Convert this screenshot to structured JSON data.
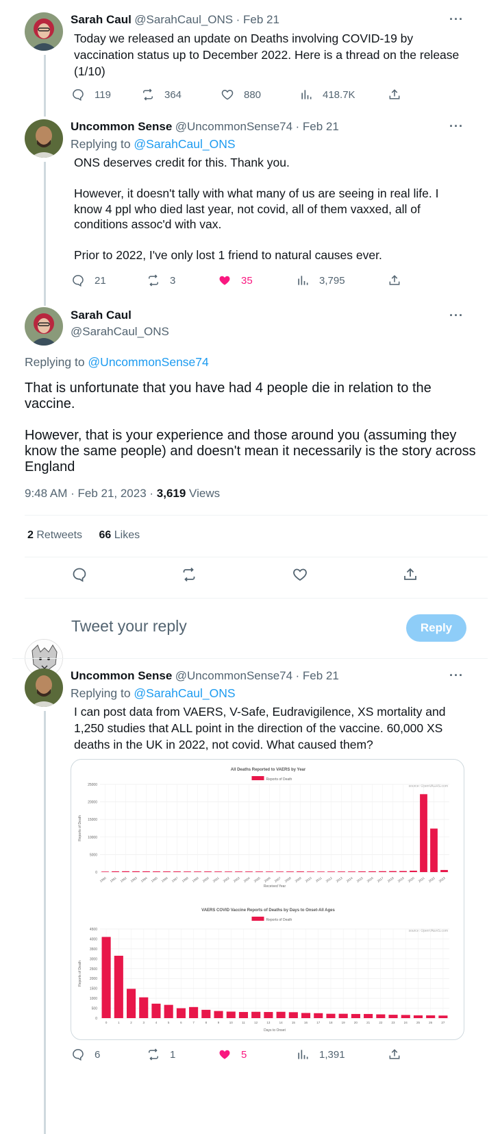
{
  "colors": {
    "accent": "#1d9bf0",
    "like": "#f91880",
    "bar": "#e8174a",
    "muted": "#536471"
  },
  "tweet1": {
    "name": "Sarah Caul",
    "handle": "@SarahCaul_ONS",
    "time": "· Feb 21",
    "text": "Today we released an update on Deaths involving COVID-19 by vaccination status up to December 2022. Here is a thread on the release (1/10)",
    "replies": "119",
    "retweets": "364",
    "likes": "880",
    "views": "418.7K"
  },
  "tweet2": {
    "name": "Uncommon Sense",
    "handle": "@UncommonSense74",
    "time": "· Feb 21",
    "replying_prefix": "Replying to ",
    "replying_to": "@SarahCaul_ONS",
    "text": "ONS deserves credit for this. Thank you.\n\nHowever, it doesn't tally with what many of us are seeing in real life. I know 4 ppl who died last year, not covid, all of them vaxxed, all of conditions assoc'd with vax.\n\nPrior to 2022, I've only lost 1 friend to natural causes ever.",
    "replies": "21",
    "retweets": "3",
    "likes": "35",
    "views": "3,795"
  },
  "main_tweet": {
    "name": "Sarah Caul",
    "handle": "@SarahCaul_ONS",
    "replying_prefix": "Replying to ",
    "replying_to": "@UncommonSense74",
    "text": "That is unfortunate that you have had 4 people die in relation to the vaccine.\n\nHowever, that is your experience and those around you (assuming they know the same people) and doesn't mean it necessarily is the story across England",
    "timestamp": "9:48 AM · Feb 21, 2023 · ",
    "views_count": "3,619",
    "views_label": " Views",
    "retweets_count": "2",
    "retweets_label": " Retweets",
    "likes_count": "66",
    "likes_label": " Likes"
  },
  "compose": {
    "placeholder": "Tweet your reply",
    "button": "Reply"
  },
  "tweet3": {
    "name": "Uncommon Sense",
    "handle": "@UncommonSense74",
    "time": "· Feb 21",
    "replying_prefix": "Replying to ",
    "replying_to": "@SarahCaul_ONS",
    "text": "I can post data from VAERS, V-Safe, Eudravigilence, XS mortality and 1,250 studies that ALL point in the direction of the vaccine. 60,000 XS deaths in the UK in 2022, not covid. What caused them?",
    "replies": "6",
    "retweets": "1",
    "likes": "5",
    "views": "1,391"
  },
  "chart_data": [
    {
      "type": "bar",
      "title": "All Deaths Reported to VAERS by Year",
      "legend": "Reports of Death",
      "source": "source: OpenVAERS.com",
      "xlabel": "Received Year",
      "ylabel": "Reports of Death",
      "ylim": [
        0,
        25000
      ],
      "yticks": [
        0,
        5000,
        10000,
        15000,
        20000,
        25000
      ],
      "categories": [
        "1990",
        "1991",
        "1992",
        "1993",
        "1994",
        "1995",
        "1996",
        "1997",
        "1998",
        "1999",
        "2000",
        "2001",
        "2002",
        "2003",
        "2004",
        "2005",
        "2006",
        "2007",
        "2008",
        "2009",
        "2010",
        "2011",
        "2012",
        "2013",
        "2014",
        "2015",
        "2016",
        "2017",
        "2018",
        "2019",
        "2020",
        "2021",
        "2022",
        "2023"
      ],
      "values": [
        150,
        220,
        240,
        230,
        220,
        200,
        190,
        190,
        170,
        170,
        180,
        170,
        160,
        170,
        170,
        170,
        160,
        160,
        170,
        190,
        160,
        150,
        160,
        170,
        170,
        200,
        220,
        250,
        280,
        300,
        400,
        22200,
        12400,
        600
      ],
      "grid": true
    },
    {
      "type": "bar",
      "title": "VAERS COVID Vaccine Reports of Deaths by Days to Onset-All Ages",
      "legend": "Reports of Death",
      "source": "source: OpenVAERS.com",
      "xlabel": "Days to Onset",
      "ylabel": "Reports of Death",
      "ylim": [
        0,
        4500
      ],
      "yticks": [
        0,
        500,
        1000,
        1500,
        2000,
        2500,
        3000,
        3500,
        4000,
        4500
      ],
      "categories": [
        "0",
        "1",
        "2",
        "3",
        "4",
        "5",
        "6",
        "7",
        "8",
        "9",
        "10",
        "11",
        "12",
        "13",
        "14",
        "15",
        "16",
        "17",
        "18",
        "19",
        "20",
        "21",
        "22",
        "23",
        "24",
        "25",
        "26",
        "27"
      ],
      "values": [
        4100,
        3150,
        1480,
        1050,
        730,
        670,
        500,
        560,
        420,
        360,
        330,
        310,
        320,
        310,
        320,
        300,
        260,
        250,
        220,
        220,
        210,
        210,
        190,
        170,
        160,
        140,
        140,
        130
      ],
      "grid": true
    }
  ]
}
